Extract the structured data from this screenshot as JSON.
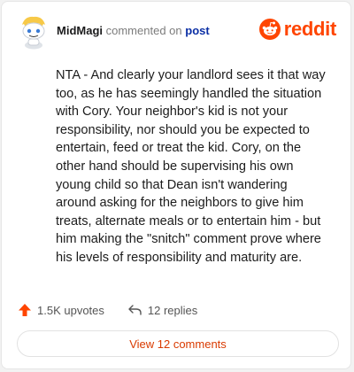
{
  "comment": {
    "username": "MidMagi",
    "action_text": "commented on",
    "post_link": "post",
    "body": "NTA - And clearly your landlord sees it that way too, as he has seemingly handled the situation with Cory. Your neighbor's kid is not your responsibility, nor should you be expected to entertain, feed or treat the kid. Cory, on the other hand should be supervising his own young child so that Dean isn't wandering around asking for the neighbors to give him treats, alternate meals or to entertain him - but him making the \"snitch\" comment prove where his levels of responsibility and maturity are."
  },
  "brand": {
    "wordmark": "reddit",
    "icon": "reddit-snoo-icon",
    "color": "#ff4500"
  },
  "actions": {
    "upvotes": "1.5K upvotes",
    "upvote_icon": "upvote-arrow-icon",
    "upvote_color": "#ff4500",
    "replies": "12 replies",
    "reply_icon": "reply-arrow-icon"
  },
  "view_comments_label": "View 12 comments",
  "colors": {
    "link": "#0b2fa5",
    "view_button_text": "#d93a00"
  }
}
